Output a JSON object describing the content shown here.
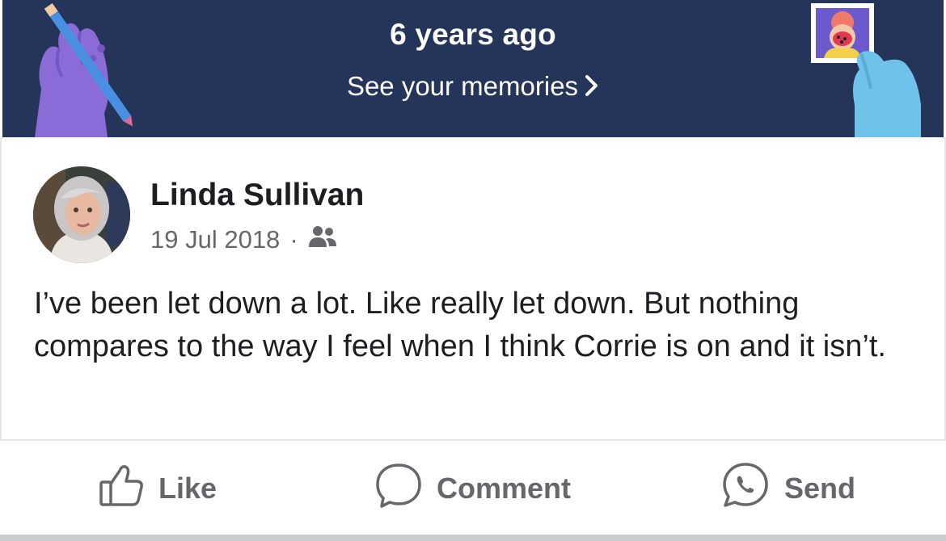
{
  "banner": {
    "title": "6 years ago",
    "link_label": "See your memories",
    "colors": {
      "background": "#25355a",
      "left_hand": "#8b6bd6",
      "right_hand": "#6fc3ea"
    }
  },
  "post": {
    "author": "Linda Sullivan",
    "date": "19 Jul 2018",
    "separator": "·",
    "audience_icon": "friends-icon",
    "text": "I’ve been let down a lot. Like really let down. But nothing compares to the way I feel when I think Corrie is on and it isn’t."
  },
  "actions": {
    "like_label": "Like",
    "comment_label": "Comment",
    "send_label": "Send",
    "like_icon": "thumbs-up-icon",
    "comment_icon": "speech-bubble-icon",
    "send_icon": "whatsapp-icon"
  },
  "colors": {
    "text_primary": "#1c1e21",
    "text_secondary": "#65676b"
  }
}
